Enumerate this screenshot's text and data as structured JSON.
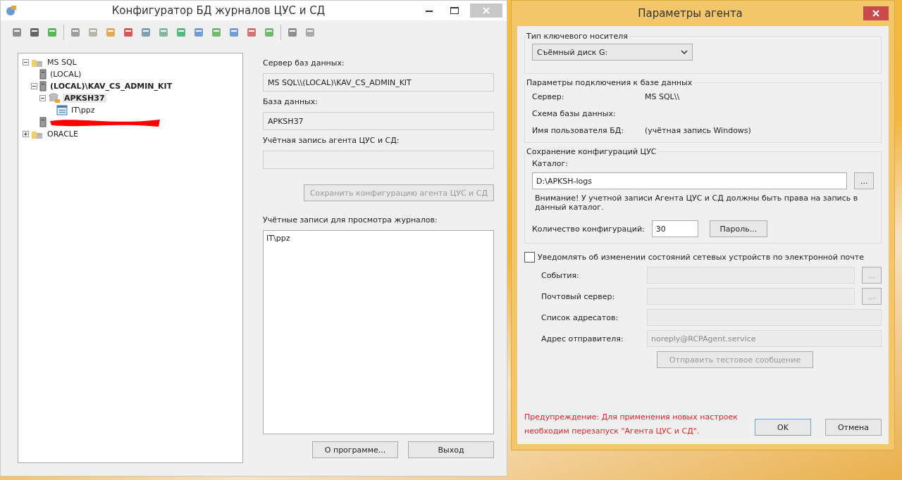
{
  "main_window": {
    "title": "Конфигуратор БД журналов ЦУС и СД",
    "tree": [
      {
        "label": "MS SQL",
        "kind": "group",
        "expanded": true,
        "children": [
          {
            "label": "(LOCAL)",
            "kind": "server",
            "bold": false
          },
          {
            "label": "(LOCAL)\\KAV_CS_ADMIN_KIT",
            "kind": "server",
            "bold": true,
            "expanded": true,
            "children": [
              {
                "label": "APKSH37",
                "kind": "database",
                "bold": true,
                "selected": true,
                "expanded": true,
                "children": [
                  {
                    "label": "IT\\ppz",
                    "kind": "account",
                    "bold": false
                  }
                ]
              }
            ]
          },
          {
            "kind": "redacted"
          }
        ]
      },
      {
        "label": "ORACLE",
        "kind": "group",
        "expanded": false
      }
    ],
    "fields": [
      {
        "label": "Сервер баз данных:",
        "value": "MS SQL\\\\(LOCAL)\\KAV_CS_ADMIN_KIT"
      },
      {
        "label": "База данных:",
        "value": "APKSH37"
      },
      {
        "label": "Учётная запись агента ЦУС и СД:"
      }
    ],
    "save_button": {
      "label": "Сохранить конфигурацию агента ЦУС и СД",
      "disabled": true
    },
    "accounts": {
      "label": "Учётные записи для просмотра журналов:",
      "items": [
        "IT\\ppz"
      ]
    },
    "buttons": [
      "О программе...",
      "Выход"
    ]
  },
  "dialog": {
    "title": "Параметры агента",
    "media_group": {
      "title": "Тип ключевого носителя",
      "select": "Съёмный диск G:"
    },
    "connection_group": {
      "title": "Параметры подключения к базе данных",
      "rows": [
        {
          "label": "Сервер:",
          "value": "MS SQL\\\\"
        },
        {
          "label": "Схема базы данных:"
        },
        {
          "label": "Имя пользователя БД:",
          "value": "(учётная запись Windows)"
        }
      ]
    },
    "save_group": {
      "title": "Сохранение конфигураций ЦУС",
      "catalog_label": "Каталог:",
      "catalog": "D:\\APKSH-logs",
      "browse": "...",
      "note": "Внимание! У учетной записи Агента ЦУС и СД должны быть права на запись в данный каталог.",
      "count_label": "Количество конфигураций:",
      "count": "30",
      "password_button": "Пароль..."
    },
    "notify": {
      "label": "Уведомлять об изменении состояний сетевых устройств по электронной почте",
      "checked": false
    },
    "mail_fields": [
      {
        "label": "События:",
        "browse": "...",
        "disabled": true
      },
      {
        "label": "Почтовый сервер:",
        "browse": "...",
        "disabled": true
      },
      {
        "label": "Список адресатов:",
        "disabled": true
      },
      {
        "label": "Адрес отправителя:",
        "value": "noreply@RCPAgent.service",
        "disabled": true
      }
    ],
    "test_button": {
      "label": "Отправить тестовое сообщение",
      "disabled": true
    },
    "warning": "Предупреждение: Для применения новых настроек необходим перезапуск \"Агента ЦУС и СД\".",
    "buttons": [
      {
        "label": "OK",
        "default": true
      },
      {
        "label": "Отмена",
        "default": false
      }
    ]
  }
}
